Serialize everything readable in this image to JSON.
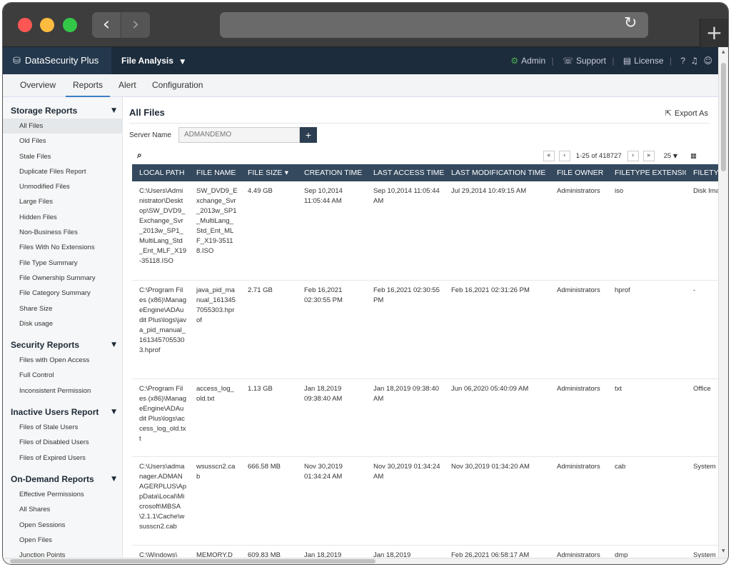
{
  "header": {
    "brand": "DataSecurity Plus",
    "module": "File Analysis",
    "admin": "Admin",
    "support": "Support",
    "license": "License",
    "help": "?"
  },
  "tabs": [
    "Overview",
    "Reports",
    "Alert",
    "Configuration"
  ],
  "sidebar": {
    "sections": [
      {
        "title": "Storage Reports",
        "items": [
          "All Files",
          "Old Files",
          "Stale Files",
          "Duplicate Files Report",
          "Unmodified Files",
          "Large Files",
          "Hidden Files",
          "Non-Business Files",
          "Files With No Extensions",
          "File Type Summary",
          "File Ownership Summary",
          "File Category Summary",
          "Share Size",
          "Disk usage"
        ]
      },
      {
        "title": "Security Reports",
        "items": [
          "Files with Open Access",
          "Full Control",
          "Inconsistent Permission"
        ]
      },
      {
        "title": "Inactive Users Report",
        "items": [
          "Files of Stale Users",
          "Files of Disabled Users",
          "Files of Expired Users"
        ]
      },
      {
        "title": "On-Demand Reports",
        "items": [
          "Effective Permissions",
          "All Shares",
          "Open Sessions",
          "Open Files",
          "Junction Points"
        ]
      }
    ]
  },
  "main": {
    "title": "All Files",
    "export_label": "Export As",
    "server_label": "Server Name",
    "server_value": "ADMANDEMO",
    "server_add": "+",
    "pager": {
      "range": "1-25 of 418727",
      "page_size": "25"
    }
  },
  "table": {
    "columns": [
      "LOCAL PATH",
      "FILE NAME",
      "FILE SIZE",
      "CREATION TIME",
      "LAST ACCESS TIME",
      "LAST MODIFICATION TIME",
      "FILE OWNER",
      "FILETYPE EXTENSION",
      "FILETYPE"
    ],
    "rows": [
      [
        "C:\\Users\\Administrator\\Desktop\\SW_DVD9_Exchange_Svr_2013w_SP1_MultiLang_Std_Ent_MLF_X19-35118.ISO",
        "SW_DVD9_Exchange_Svr_2013w_SP1_MultiLang_Std_Ent_MLF_X19-35118.ISO",
        "4.49 GB",
        "Sep 10,2014 11:05:44 AM",
        "Sep 10,2014 11:05:44 AM",
        "Jul 29,2014 10:49:15 AM",
        "Administrators",
        "iso",
        "Disk Image"
      ],
      [
        "C:\\Program Files (x86)\\ManageEngine\\ADAudit Plus\\logs\\java_pid_manual_1613457055303.hprof",
        "java_pid_manual_1613457055303.hprof",
        "2.71 GB",
        "Feb 16,2021 02:30:55 PM",
        "Feb 16,2021 02:30:55 PM",
        "Feb 16,2021 02:31:26 PM",
        "Administrators",
        "hprof",
        "-"
      ],
      [
        "C:\\Program Files (x86)\\ManageEngine\\ADAudit Plus\\logs\\access_log_old.txt",
        "access_log_old.txt",
        "1.13 GB",
        "Jan 18,2019 09:38:40 AM",
        "Jan 18,2019 09:38:40 AM",
        "Jun 06,2020 05:40:09 AM",
        "Administrators",
        "txt",
        "Office"
      ],
      [
        "C:\\Users\\admanager.ADMANAGERPLUS\\AppData\\Local\\Microsoft\\MBSA\\2.1.1\\Cache\\wsusscn2.cab",
        "wsusscn2.cab",
        "666.58 MB",
        "Nov 30,2019 01:34:24 AM",
        "Nov 30,2019 01:34:24 AM",
        "Nov 30,2019 01:34:20 AM",
        "Administrators",
        "cab",
        "System"
      ],
      [
        "C:\\Windows\\",
        "MEMORY.DMP",
        "609.83 MB",
        "Jan 18,2019",
        "Jan 18,2019",
        "Feb 26,2021 06:58:17 AM",
        "Administrators",
        "dmp",
        "System"
      ]
    ]
  }
}
